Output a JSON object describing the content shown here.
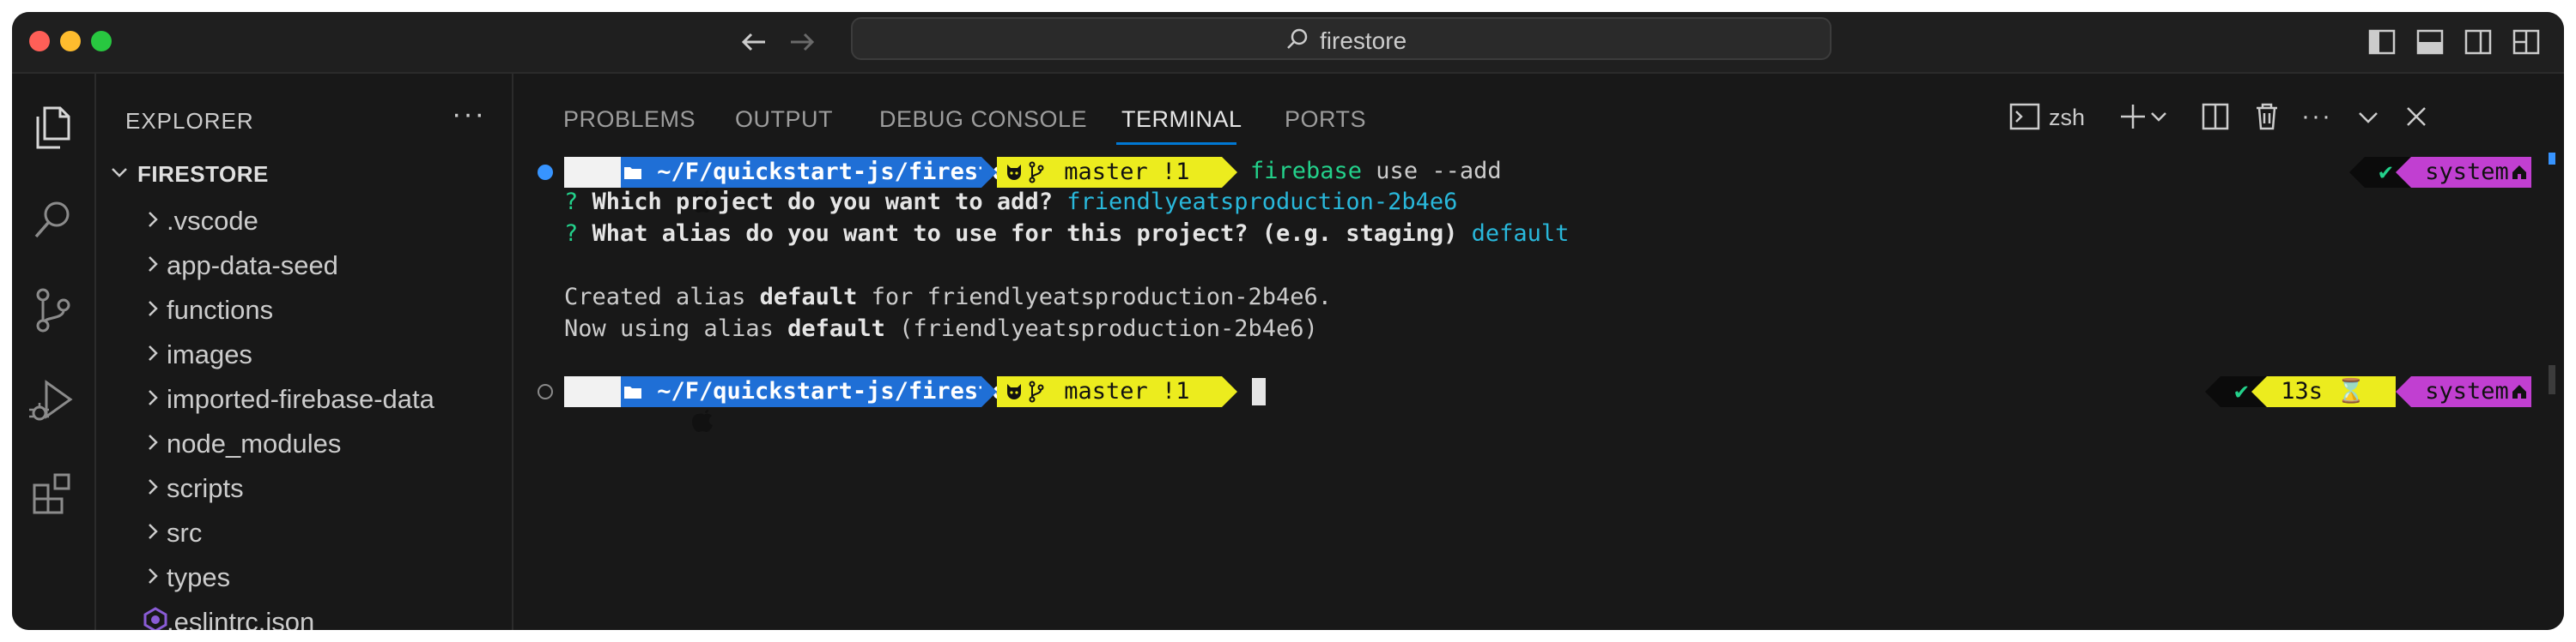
{
  "window": {
    "search_text": "firestore"
  },
  "sidebar": {
    "title": "EXPLORER",
    "more_label": "···",
    "root_folder": "FIRESTORE",
    "items": [
      {
        "label": ".vscode",
        "type": "folder"
      },
      {
        "label": "app-data-seed",
        "type": "folder"
      },
      {
        "label": "functions",
        "type": "folder"
      },
      {
        "label": "images",
        "type": "folder"
      },
      {
        "label": "imported-firebase-data",
        "type": "folder"
      },
      {
        "label": "node_modules",
        "type": "folder"
      },
      {
        "label": "scripts",
        "type": "folder"
      },
      {
        "label": "src",
        "type": "folder"
      },
      {
        "label": "types",
        "type": "folder"
      },
      {
        "label": ".eslintrc.json",
        "type": "file"
      }
    ]
  },
  "panel": {
    "tabs": [
      "PROBLEMS",
      "OUTPUT",
      "DEBUG CONSOLE",
      "TERMINAL",
      "PORTS"
    ],
    "active_tab": "TERMINAL",
    "shell_label": "zsh",
    "more_label": "···"
  },
  "terminal": {
    "prompt1": {
      "path": " ~/F/quickstart-js/firestore ",
      "git": " master !1 ",
      "cmd_name": "firebase",
      "cmd_rest": " use --add",
      "status": " ✔ ",
      "env": " system "
    },
    "q1_mark": "?",
    "q1_text": " Which project do you want to add?",
    "q1_answer": " friendlyeatsproduction-2b4e6",
    "q2_mark": "?",
    "q2_text": " What alias do you want to use for this project? (e.g. staging)",
    "q2_answer": " default",
    "out1_a": "Created alias ",
    "out1_b": "default",
    "out1_c": " for friendlyeatsproduction-2b4e6.",
    "out2_a": "Now using alias ",
    "out2_b": "default",
    "out2_c": " (friendlyeatsproduction-2b4e6)",
    "prompt2": {
      "path": " ~/F/quickstart-js/firestore ",
      "git": " master !1 ",
      "status": " ✔ ",
      "duration": " 13s ⌛ ",
      "env": " system "
    }
  },
  "colors": {
    "accent": "#0078d4",
    "prompt_path": "#1f6fd6",
    "prompt_git": "#ecec1e",
    "prompt_env": "#c13fd1",
    "success": "#23d18b",
    "link": "#29b8db"
  }
}
